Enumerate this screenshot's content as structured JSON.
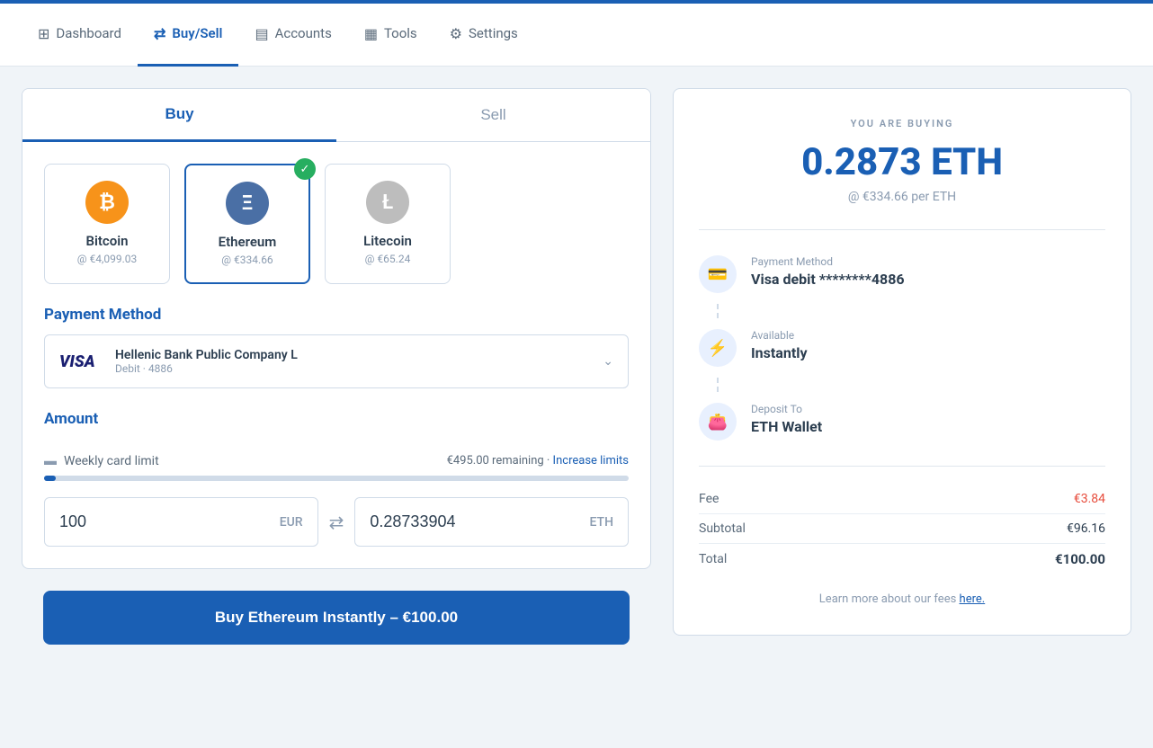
{
  "topAccent": true,
  "nav": {
    "items": [
      {
        "id": "dashboard",
        "label": "Dashboard",
        "icon": "⊞",
        "active": false
      },
      {
        "id": "buysell",
        "label": "Buy/Sell",
        "icon": "⇄",
        "active": true
      },
      {
        "id": "accounts",
        "label": "Accounts",
        "icon": "▤",
        "active": false
      },
      {
        "id": "tools",
        "label": "Tools",
        "icon": "▦",
        "active": false
      },
      {
        "id": "settings",
        "label": "Settings",
        "icon": "⚙",
        "active": false
      }
    ]
  },
  "tabs": {
    "buy_label": "Buy",
    "sell_label": "Sell",
    "active": "buy"
  },
  "cryptos": [
    {
      "id": "bitcoin",
      "name": "Bitcoin",
      "price": "@ €4,099.03",
      "icon": "₿",
      "icon_class": "btc-icon",
      "selected": false
    },
    {
      "id": "ethereum",
      "name": "Ethereum",
      "price": "@ €334.66",
      "icon": "Ξ",
      "icon_class": "eth-icon",
      "selected": true
    },
    {
      "id": "litecoin",
      "name": "Litecoin",
      "price": "@ €65.24",
      "icon": "Ł",
      "icon_class": "ltc-icon",
      "selected": false
    }
  ],
  "payment": {
    "section_label": "Payment Method",
    "bank_name": "Hellenic Bank Public Company L",
    "card_type": "Debit · 4886"
  },
  "amount": {
    "section_label": "Amount",
    "limit_label": "Weekly card limit",
    "limit_remaining": "€495.00 remaining",
    "separator": "·",
    "increase_link": "Increase limits",
    "progress_percent": 2,
    "eur_value": "100",
    "eur_currency": "EUR",
    "eth_value": "0.28733904",
    "eth_currency": "ETH"
  },
  "buy_button": {
    "label": "Buy Ethereum Instantly – €100.00"
  },
  "summary": {
    "you_are_buying": "YOU ARE BUYING",
    "amount": "0.2873 ETH",
    "rate": "@ €334.66 per ETH",
    "payment_method_label": "Payment Method",
    "payment_method_value": "Visa debit ********4886",
    "available_label": "Available",
    "available_value": "Instantly",
    "deposit_label": "Deposit To",
    "deposit_value": "ETH Wallet",
    "fee_label": "Fee",
    "fee_value": "€3.84",
    "subtotal_label": "Subtotal",
    "subtotal_value": "€96.16",
    "total_label": "Total",
    "total_value": "€100.00",
    "footer_note": "Learn more about our fees ",
    "footer_link": "here."
  }
}
